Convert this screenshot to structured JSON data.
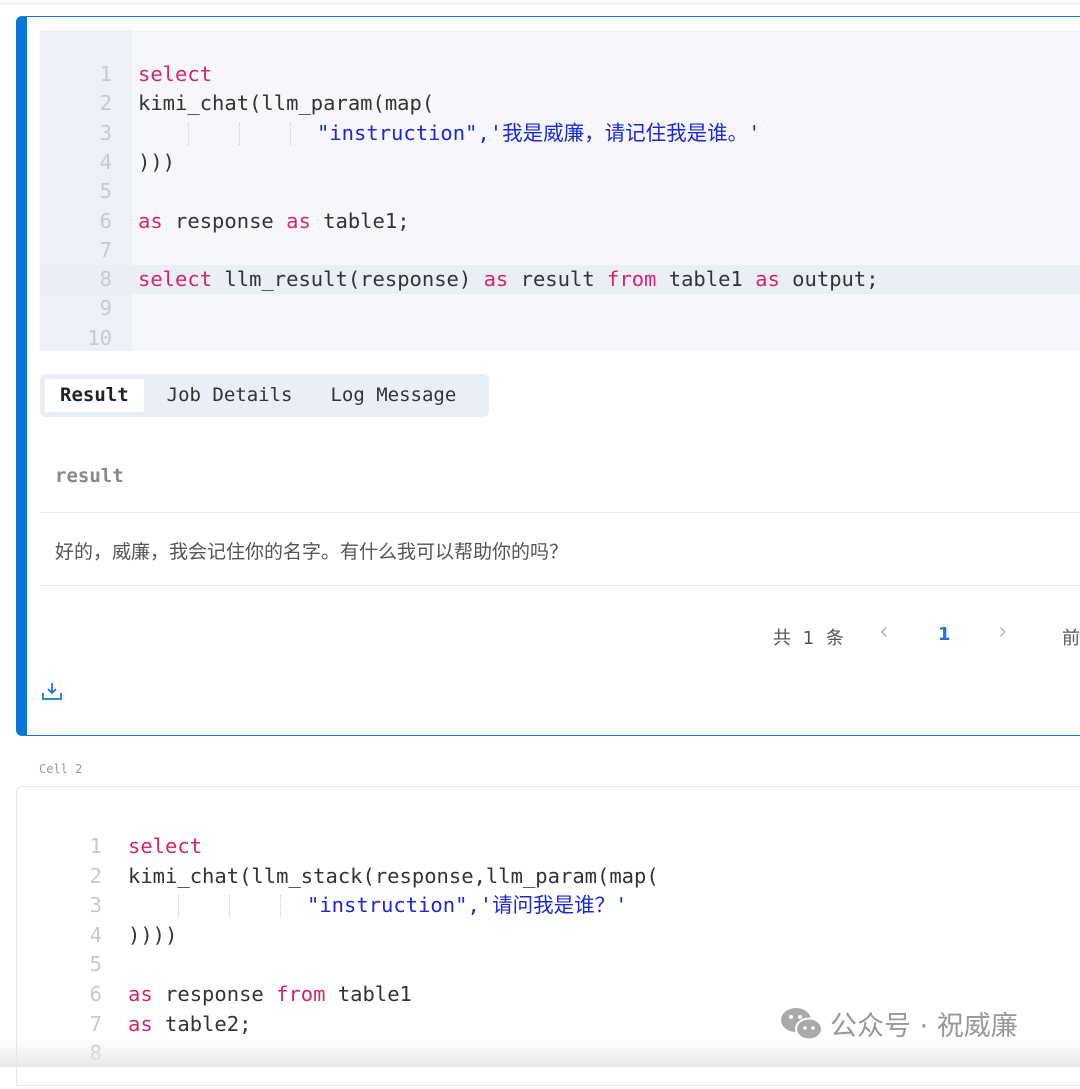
{
  "cell1": {
    "code": [
      [
        {
          "t": "select",
          "c": "kw"
        }
      ],
      [
        {
          "t": "kimi_chat(llm_param(map(",
          "c": "pl"
        }
      ],
      [
        {
          "g": true
        },
        {
          "t": "\"instruction\",'我是威廉，请记住我是谁。'",
          "c": "str"
        }
      ],
      [
        {
          "t": ")))",
          "c": "pl"
        }
      ],
      [],
      [
        {
          "t": "as",
          "c": "kw"
        },
        {
          "t": " response ",
          "c": "pl"
        },
        {
          "t": "as",
          "c": "kw"
        },
        {
          "t": " table1;",
          "c": "pl"
        }
      ],
      [],
      [
        {
          "t": "select",
          "c": "kw"
        },
        {
          "t": " llm_result(response) ",
          "c": "pl"
        },
        {
          "t": "as",
          "c": "kw"
        },
        {
          "t": " result ",
          "c": "pl"
        },
        {
          "t": "from",
          "c": "kw"
        },
        {
          "t": " table1 ",
          "c": "pl"
        },
        {
          "t": "as",
          "c": "kw"
        },
        {
          "t": " output;",
          "c": "pl"
        }
      ],
      [],
      []
    ],
    "active_line": 8,
    "tabs": [
      "Result",
      "Job Details",
      "Log Message"
    ],
    "active_tab": "Result",
    "column": "result",
    "row": "好的，威廉，我会记住你的名字。有什么我可以帮助你的吗？",
    "pagination": {
      "total": "共 1 条",
      "prev": "‹",
      "page": "1",
      "next": "›",
      "more": "前"
    }
  },
  "cell2": {
    "label": "Cell 2",
    "code": [
      [
        {
          "t": "select",
          "c": "kw"
        }
      ],
      [
        {
          "t": "kimi_chat(llm_stack(response,llm_param(map(",
          "c": "pl"
        }
      ],
      [
        {
          "g": true
        },
        {
          "t": "\"instruction\",'请问我是谁？'",
          "c": "str"
        }
      ],
      [
        {
          "t": "))))",
          "c": "pl"
        }
      ],
      [],
      [
        {
          "t": "as",
          "c": "kw"
        },
        {
          "t": " response ",
          "c": "pl"
        },
        {
          "t": "from",
          "c": "kw"
        },
        {
          "t": " table1",
          "c": "pl"
        }
      ],
      [
        {
          "t": "as",
          "c": "kw"
        },
        {
          "t": " table2;",
          "c": "pl"
        }
      ],
      []
    ]
  },
  "watermark": "公众号 · 祝威廉",
  "colors": {
    "accent": "#0b76da",
    "keyword": "#d6246e",
    "string": "#1b28d6"
  }
}
